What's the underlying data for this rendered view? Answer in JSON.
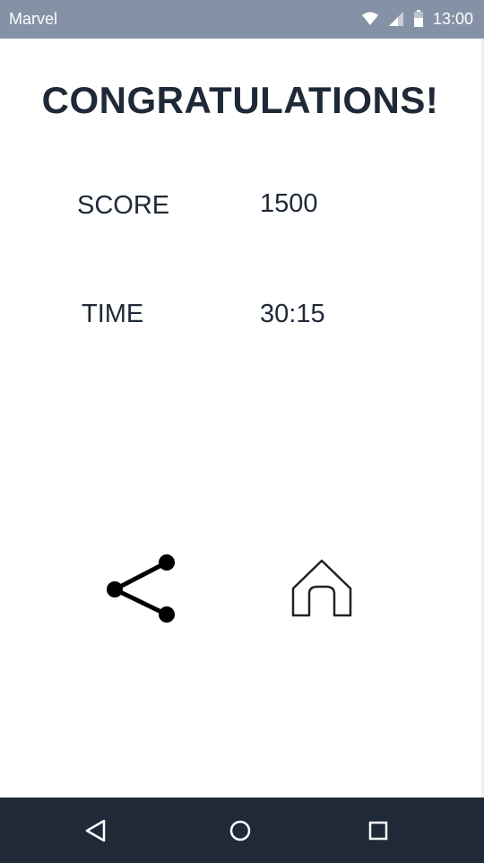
{
  "status_bar": {
    "app_name": "Marvel",
    "time": "13:00",
    "icons": [
      "wifi-icon",
      "cell-signal-icon",
      "battery-icon"
    ]
  },
  "results": {
    "title": "CONGRATULATIONS!",
    "score_label": "SCORE",
    "score_value": "1500",
    "time_label": "TIME",
    "time_value": "30:15"
  },
  "actions": [
    {
      "name": "share",
      "icon": "share-icon"
    },
    {
      "name": "home",
      "icon": "home-icon"
    }
  ],
  "nav_bar": {
    "buttons": [
      "back-icon",
      "home-circle-icon",
      "recent-apps-icon"
    ]
  },
  "colors": {
    "status_bar_bg": "#8592a6",
    "nav_bar_bg": "#1f2937",
    "text": "#1f2937",
    "background": "#ffffff"
  }
}
